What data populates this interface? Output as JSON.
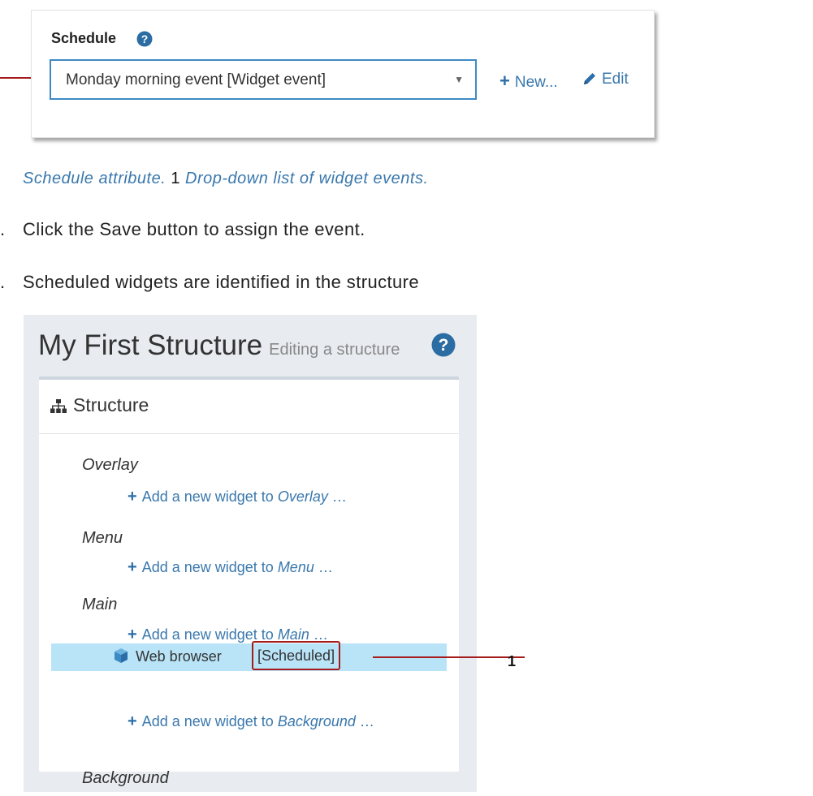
{
  "schedule_panel": {
    "label": "Schedule",
    "selected_value": "Monday morning event [Widget event]",
    "new_label": "New...",
    "edit_label": "Edit"
  },
  "caption": {
    "title": "Schedule attribute.",
    "number": "1",
    "text": "Drop-down list of widget events."
  },
  "steps": [
    "Click the Save button to assign the event.",
    "Scheduled widgets are identified in the structure"
  ],
  "structure": {
    "title": "My First Structure",
    "subtitle": "Editing a structure",
    "card_title": "Structure",
    "add_prefix": "Add a new widget to",
    "ellipsis": "…",
    "regions": [
      {
        "name": "Overlay"
      },
      {
        "name": "Menu"
      },
      {
        "name": "Main"
      },
      {
        "name": "Background"
      }
    ],
    "widget": {
      "name": "Web browser",
      "badge": "[Scheduled]"
    },
    "callout_number": "1"
  },
  "icons": {
    "help": "help-circle-icon",
    "plus": "plus-icon",
    "pencil": "pencil-icon",
    "sitemap": "sitemap-icon",
    "cube": "cube-icon",
    "caret": "caret-down-icon"
  },
  "colors": {
    "link": "#3a78ad",
    "select_border": "#3d8ac4",
    "callout": "#a51c1c",
    "highlight": "#b9e4f8"
  }
}
